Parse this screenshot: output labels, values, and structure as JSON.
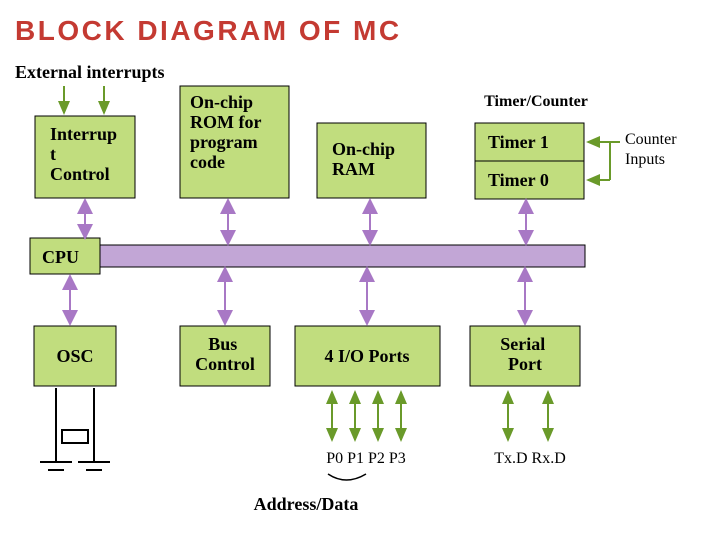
{
  "title": "BLOCK DIAGRAM OF MC",
  "headers": {
    "ext_int": "External interrupts",
    "tc": "Timer/Counter",
    "counter_in": "Counter\nInputs"
  },
  "blocks": {
    "interrupt": "Interrup\nt\nControl",
    "rom": "On-chip\nROM for\nprogram\ncode",
    "ram": "On-chip\nRAM",
    "timer1": "Timer 1",
    "timer0": "Timer 0",
    "cpu": "CPU",
    "osc": "OSC",
    "bus": "Bus\nControl",
    "io": "4 I/O Ports",
    "serial": "Serial\nPort"
  },
  "labels": {
    "ports": "P0 P1 P2 P3",
    "txrx": "Tx.D  Rx.D",
    "addrdata": "Address/Data"
  }
}
